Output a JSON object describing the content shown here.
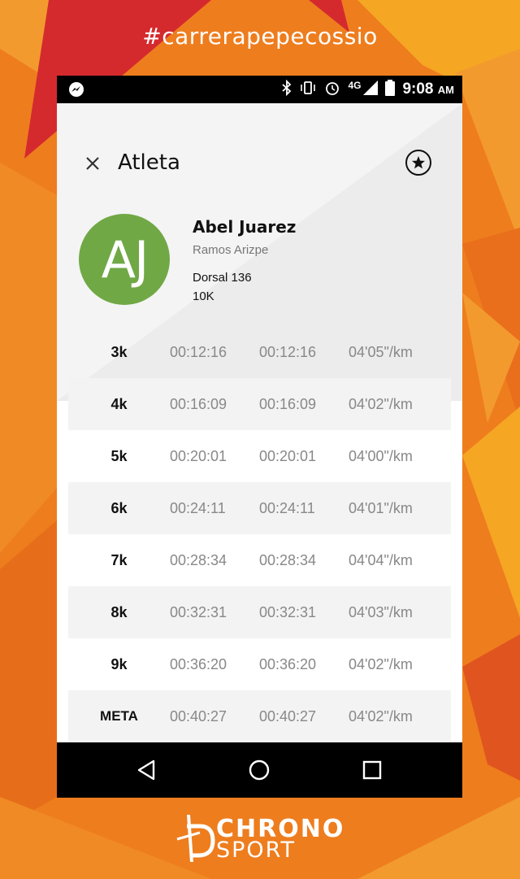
{
  "hashtag": "#carrerapepecossio",
  "status_bar": {
    "time": "9:08",
    "ampm": "AM",
    "network": "4G",
    "icons": [
      "messenger-icon",
      "bluetooth-icon",
      "vibrate-icon",
      "alarm-icon",
      "signal-icon",
      "battery-icon"
    ]
  },
  "toolbar": {
    "title": "Atleta",
    "close_icon": "close-icon",
    "favorite_icon": "star-icon"
  },
  "athlete": {
    "initials": "AJ",
    "name": "Abel Juarez",
    "city": "Ramos Arizpe",
    "bib": "Dorsal 136",
    "distance": "10K",
    "avatar_color": "#70a845"
  },
  "splits": [
    {
      "split": "3k",
      "time": "00:12:16",
      "time2": "00:12:16",
      "pace": "04'05\"/km"
    },
    {
      "split": "4k",
      "time": "00:16:09",
      "time2": "00:16:09",
      "pace": "04'02\"/km"
    },
    {
      "split": "5k",
      "time": "00:20:01",
      "time2": "00:20:01",
      "pace": "04'00\"/km"
    },
    {
      "split": "6k",
      "time": "00:24:11",
      "time2": "00:24:11",
      "pace": "04'01\"/km"
    },
    {
      "split": "7k",
      "time": "00:28:34",
      "time2": "00:28:34",
      "pace": "04'04\"/km"
    },
    {
      "split": "8k",
      "time": "00:32:31",
      "time2": "00:32:31",
      "pace": "04'03\"/km"
    },
    {
      "split": "9k",
      "time": "00:36:20",
      "time2": "00:36:20",
      "pace": "04'02\"/km"
    },
    {
      "split": "META",
      "time": "00:40:27",
      "time2": "00:40:27",
      "pace": "04'02\"/km"
    }
  ],
  "nav": {
    "icons": [
      "back-icon",
      "home-icon",
      "recents-icon"
    ]
  },
  "brand": {
    "line1": "CHRONO",
    "line2": "SPORT"
  },
  "colors": {
    "background": "#ee7d1e",
    "accent_red": "#d42a2e",
    "accent_yellow": "#f5a623"
  }
}
